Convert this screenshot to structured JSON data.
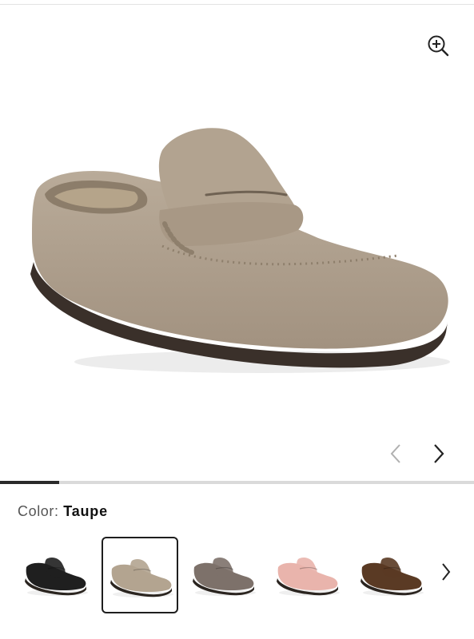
{
  "gallery": {
    "zoom_icon": "zoom-in-icon",
    "prev_icon": "chevron-left-icon",
    "next_icon": "chevron-right-icon",
    "image_position": {
      "current": 1,
      "fraction": 0.125
    }
  },
  "color": {
    "label": "Color:",
    "selected": "Taupe"
  },
  "swatches": [
    {
      "color": "#1f1f1f",
      "selected": false
    },
    {
      "color": "#b3a490",
      "selected": true
    },
    {
      "color": "#7d716a",
      "selected": false
    },
    {
      "color": "#e9b4ac",
      "selected": false
    },
    {
      "color": "#5a3a24",
      "selected": false
    }
  ],
  "swatch_scroll_icon": "chevron-right-icon"
}
